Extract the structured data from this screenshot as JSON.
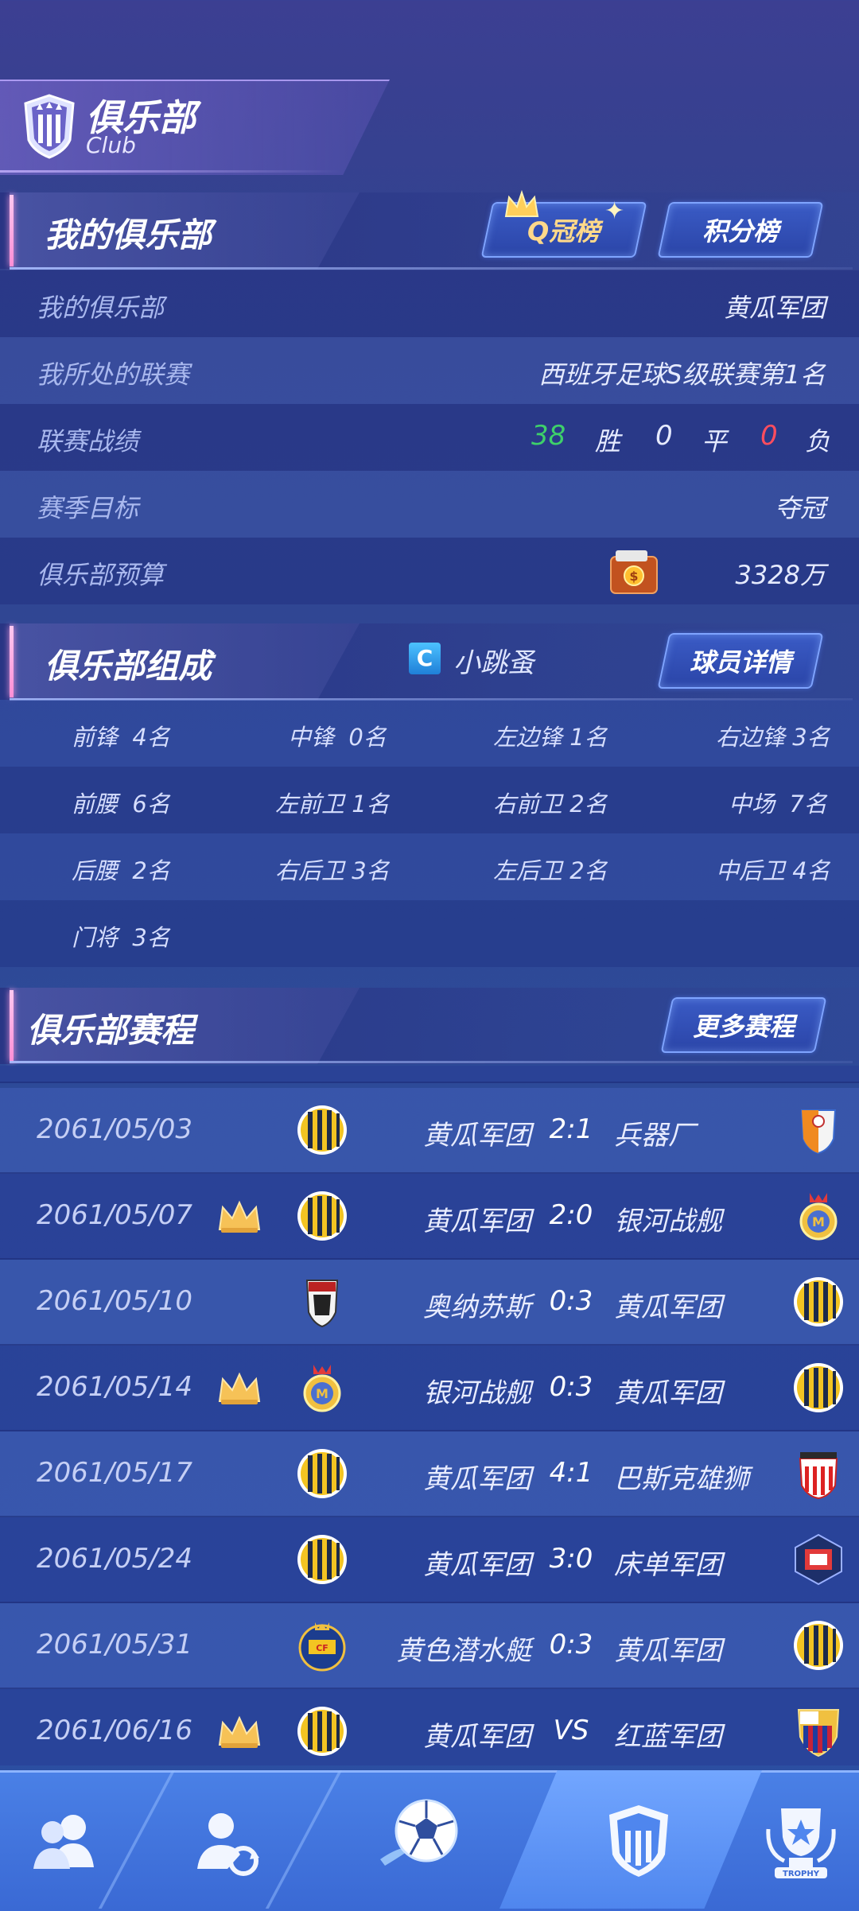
{
  "header": {
    "title": "俱乐部",
    "subtitle": "Club"
  },
  "my_club": {
    "section_title": "我的俱乐部",
    "ranking_button": "Q冠榜",
    "points_button": "积分榜",
    "rows": [
      {
        "label": "我的俱乐部",
        "value": "黄瓜军团"
      },
      {
        "label": "我所处的联赛",
        "value": "西班牙足球S级联赛第1名"
      },
      {
        "label": "联赛战绩"
      },
      {
        "label": "赛季目标",
        "value": "夺冠"
      },
      {
        "label": "俱乐部预算",
        "value": "3328万"
      }
    ],
    "record": {
      "wins": "38",
      "win_label": "胜",
      "draws": "0",
      "draw_label": "平",
      "losses": "0",
      "loss_label": "负"
    },
    "colors": {
      "win": "#3ed06a",
      "loss": "#ff4d5e"
    }
  },
  "composition": {
    "section_title": "俱乐部组成",
    "coach_badge": "C",
    "coach_name": "小跳蚤",
    "details_button": "球员详情",
    "rows": [
      [
        "前锋  4名",
        "中锋  0名",
        "左边锋 1名",
        "右边锋 3名"
      ],
      [
        "前腰  6名",
        "左前卫 1名",
        "右前卫 2名",
        "中场  7名"
      ],
      [
        "后腰  2名",
        "右后卫 3名",
        "左后卫 2名",
        "中后卫 4名"
      ],
      [
        "门将  3名"
      ]
    ]
  },
  "schedule": {
    "section_title": "俱乐部赛程",
    "more_button": "更多赛程",
    "matches": [
      {
        "date": "2061/05/03",
        "crown": false,
        "home": "黄瓜军团",
        "score": "2:1",
        "away": "兵器厂",
        "home_badge": "yellow-black-badge",
        "away_badge": "orange-white-badge"
      },
      {
        "date": "2061/05/07",
        "crown": true,
        "home": "黄瓜军团",
        "score": "2:0",
        "away": "银河战舰",
        "home_badge": "yellow-black-badge",
        "away_badge": "gold-crest-badge"
      },
      {
        "date": "2061/05/10",
        "crown": false,
        "home": "奥纳苏斯",
        "score": "0:3",
        "away": "黄瓜军团",
        "home_badge": "red-shield-badge",
        "away_badge": "yellow-black-badge"
      },
      {
        "date": "2061/05/14",
        "crown": true,
        "home": "银河战舰",
        "score": "0:3",
        "away": "黄瓜军团",
        "home_badge": "gold-crest-badge",
        "away_badge": "yellow-black-badge"
      },
      {
        "date": "2061/05/17",
        "crown": false,
        "home": "黄瓜军团",
        "score": "4:1",
        "away": "巴斯克雄狮",
        "home_badge": "yellow-black-badge",
        "away_badge": "red-white-stripe-badge"
      },
      {
        "date": "2061/05/24",
        "crown": false,
        "home": "黄瓜军团",
        "score": "3:0",
        "away": "床单军团",
        "home_badge": "yellow-black-badge",
        "away_badge": "navy-red-badge"
      },
      {
        "date": "2061/05/31",
        "crown": false,
        "home": "黄色潜水艇",
        "score": "0:3",
        "away": "黄瓜军团",
        "home_badge": "yellow-submarine-badge",
        "away_badge": "yellow-black-badge"
      },
      {
        "date": "2061/06/16",
        "crown": true,
        "home": "黄瓜军团",
        "score": "VS",
        "away": "红蓝军团",
        "home_badge": "yellow-black-badge",
        "away_badge": "blue-red-badge"
      }
    ]
  },
  "bottom_nav": {
    "items": [
      {
        "icon": "team-icon",
        "active": false
      },
      {
        "icon": "transfer-icon",
        "active": false
      },
      {
        "icon": "soccer-ball-icon",
        "active": false
      },
      {
        "icon": "club-icon",
        "active": true
      },
      {
        "icon": "trophy-icon",
        "active": false,
        "label": "TROPHY"
      }
    ]
  }
}
